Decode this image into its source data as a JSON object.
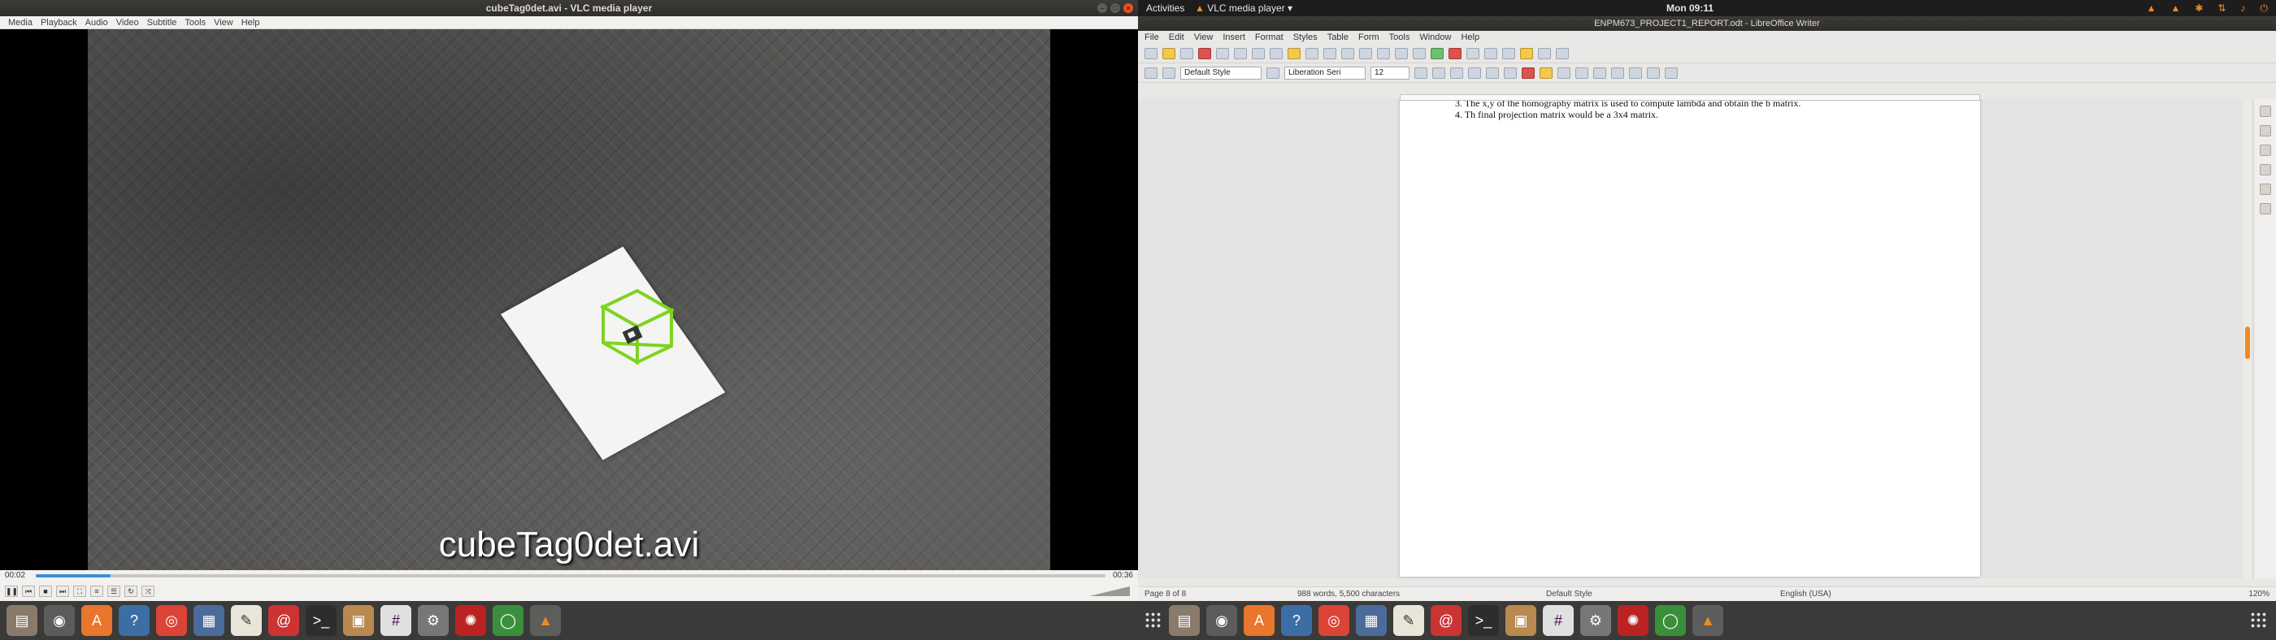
{
  "vlc": {
    "window_title": "cubeTag0det.avi - VLC media player",
    "menu": [
      "Media",
      "Playback",
      "Audio",
      "Video",
      "Subtitle",
      "Tools",
      "View",
      "Help"
    ],
    "caption": "cubeTag0det.avi",
    "time_current": "00:02",
    "time_total": "00:36",
    "progress_fraction": 0.07,
    "controls": [
      "pause",
      "prev",
      "stop",
      "next",
      "fullscreen",
      "extended",
      "playlist",
      "loop",
      "shuffle"
    ]
  },
  "topbar": {
    "activities": "Activities",
    "app_menu": "VLC media player",
    "clock": "Mon 09:11"
  },
  "writer": {
    "window_title": "ENPM673_PROJECT1_REPORT.odt - LibreOffice Writer",
    "menu": [
      "File",
      "Edit",
      "View",
      "Insert",
      "Format",
      "Styles",
      "Table",
      "Form",
      "Tools",
      "Window",
      "Help"
    ],
    "paragraph_style": "Default Style",
    "font_name": "Liberation Seri",
    "font_size": "12",
    "doc_lines": [
      "3. The x,y of the homography matrix is used to compute lambda and obtain the b matrix.",
      "4. Th final projection matrix would be a 3x4 matrix."
    ],
    "status": {
      "page": "Page 8 of 8",
      "words": "988 words, 5,500 characters",
      "style": "Default Style",
      "language": "English (USA)",
      "zoom": "120%"
    }
  },
  "dock_icons": [
    "files-icon",
    "rhythmbox-icon",
    "software-icon",
    "help-icon",
    "chrome-icon",
    "docs-icon",
    "editor-icon",
    "debian-icon",
    "terminal-icon",
    "archive-icon",
    "slack-icon",
    "settings-icon",
    "ros-icon",
    "sync-icon",
    "vlc-icon"
  ]
}
